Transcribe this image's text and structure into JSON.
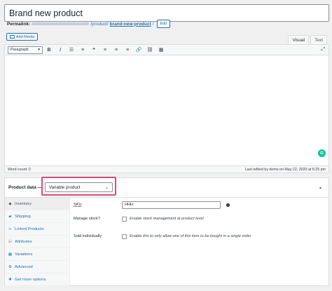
{
  "title_value": "Brand new product",
  "permalink": {
    "label": "Permalink:",
    "path": "/product/",
    "slug": "brand-new-product",
    "trailing": "/",
    "edit_label": "Edit"
  },
  "add_media_label": "Add Media",
  "editor_tabs": {
    "visual": "Visual",
    "text": "Text"
  },
  "toolbar": {
    "format_value": "Paragraph",
    "buttons": [
      "bold-button",
      "italic-button",
      "bullet-list-button",
      "numbered-list-button",
      "blockquote-button",
      "align-left-button",
      "align-center-button",
      "align-right-button",
      "link-button",
      "unlink-button",
      "toolbar-toggle-button"
    ]
  },
  "status": {
    "word_count": "Word count: 0",
    "last_edited": "Last edited by demo on May 22, 2020 at 6:25 pm"
  },
  "product_data": {
    "label": "Product data —",
    "type_value": "Variable product",
    "highlight_color": "#e2477a",
    "tabs": [
      {
        "label": "Inventory",
        "icon": "inventory-icon"
      },
      {
        "label": "Shipping",
        "icon": "truck-icon"
      },
      {
        "label": "Linked Products",
        "icon": "link-icon"
      },
      {
        "label": "Attributes",
        "icon": "list-icon"
      },
      {
        "label": "Variations",
        "icon": "grid-icon"
      },
      {
        "label": "Advanced",
        "icon": "gear-icon"
      },
      {
        "label": "Get more options",
        "icon": "plugin-icon"
      }
    ],
    "fields": {
      "sku_label": "SKU",
      "sku_value": "HHH",
      "manage_stock_label": "Manage stock?",
      "manage_stock_desc": "Enable stock management at product level",
      "sold_individually_label": "Sold individually",
      "sold_individually_desc": "Enable this to only allow one of this item to be bought in a single order"
    }
  },
  "colors": {
    "link": "#2271b1",
    "background": "#f0f0f1"
  }
}
